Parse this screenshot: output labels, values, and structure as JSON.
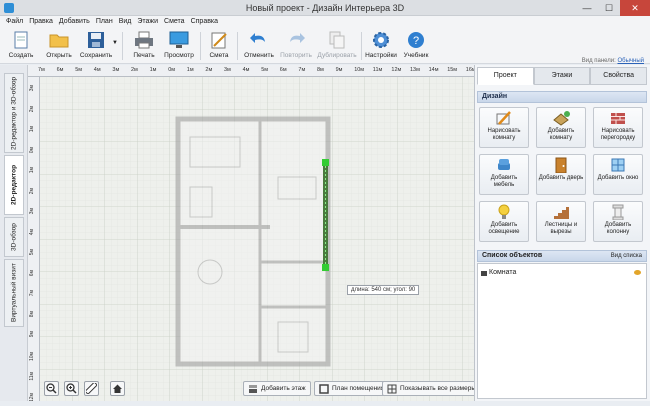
{
  "window": {
    "title": "Новый проект - Дизайн Интерьера 3D"
  },
  "menu": [
    "Файл",
    "Правка",
    "Добавить",
    "План",
    "Вид",
    "Этажи",
    "Смета",
    "Справка"
  ],
  "toolbar": {
    "create": "Создать",
    "open": "Открыть",
    "save": "Сохранить",
    "print": "Печать",
    "preview": "Просмотр",
    "estimate": "Смета",
    "undo": "Отменить",
    "redo": "Повторить",
    "duplicate": "Дублировать",
    "settings": "Настройки",
    "tutorial": "Учебник"
  },
  "panel_view": {
    "label": "Вид панели:",
    "value": "Обычный"
  },
  "left_tabs": [
    "2D-редактор и 3D-обзор",
    "2D-редактор",
    "3D-обзор",
    "Виртуальный визит"
  ],
  "ruler_h": [
    "7м",
    "6м",
    "5м",
    "4м",
    "3м",
    "2м",
    "1м",
    "0м",
    "1м",
    "2м",
    "3м",
    "4м",
    "5м",
    "6м",
    "7м",
    "8м",
    "9м",
    "10м",
    "11м",
    "12м",
    "13м",
    "14м",
    "15м",
    "16м"
  ],
  "ruler_v": [
    "3м",
    "2м",
    "1м",
    "0м",
    "1м",
    "2м",
    "3м",
    "4м",
    "5м",
    "6м",
    "7м",
    "8м",
    "9м",
    "10м",
    "11м",
    "12м"
  ],
  "canvas": {
    "hint": "длина: 540 см; угол: 90"
  },
  "bottom": {
    "add_floor": "Добавить этаж",
    "room_plan": "План помещения",
    "show_dims": "Показывать все размеры"
  },
  "right_tabs": [
    "Проект",
    "Этажи",
    "Свойства"
  ],
  "design": {
    "header": "Дизайн",
    "items": [
      "Нарисовать комнату",
      "Добавить комнату",
      "Нарисовать перегородку",
      "Добавить мебель",
      "Добавить дверь",
      "Добавить окно",
      "Добавить освещение",
      "Лестницы и вырезы",
      "Добавить колонну"
    ]
  },
  "objects": {
    "header": "Список объектов",
    "view": "Вид списка",
    "items": [
      "Комната"
    ]
  }
}
